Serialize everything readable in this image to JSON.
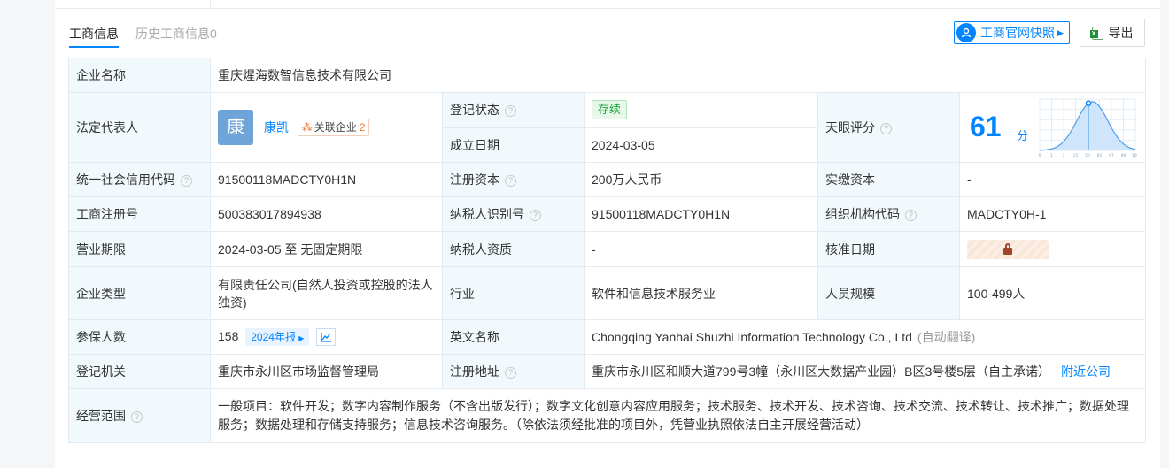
{
  "tabs": {
    "active": "工商信息",
    "history": "历史工商信息0"
  },
  "actions": {
    "official_snapshot": "工商官网快照",
    "export": "导出"
  },
  "info": {
    "company_name_label": "企业名称",
    "company_name": "重庆煋海数智信息技术有限公司",
    "legal_rep_label": "法定代表人",
    "legal_rep_avatar": "康",
    "legal_rep_name": "康凯",
    "legal_rep_assoc_label": "关联企业",
    "legal_rep_assoc_count": "2",
    "reg_status_label": "登记状态",
    "reg_status": "存续",
    "found_date_label": "成立日期",
    "found_date": "2024-03-05",
    "rating_label": "天眼评分",
    "rating_score": "61",
    "rating_unit": "分",
    "credit_code_label": "统一社会信用代码",
    "credit_code": "91500118MADCTY0H1N",
    "reg_capital_label": "注册资本",
    "reg_capital": "200万人民币",
    "paid_capital_label": "实缴资本",
    "paid_capital": "-",
    "reg_no_label": "工商注册号",
    "reg_no": "500383017894938",
    "taxpayer_id_label": "纳税人识别号",
    "taxpayer_id": "91500118MADCTY0H1N",
    "org_code_label": "组织机构代码",
    "org_code": "MADCTY0H-1",
    "term_label": "营业期限",
    "term": "2024-03-05 至 无固定期限",
    "taxpayer_qual_label": "纳税人资质",
    "taxpayer_qual": "-",
    "approval_date_label": "核准日期",
    "company_type_label": "企业类型",
    "company_type": "有限责任公司(自然人投资或控股的法人独资)",
    "industry_label": "行业",
    "industry": "软件和信息技术服务业",
    "staff_size_label": "人员规模",
    "staff_size": "100-499人",
    "insured_label": "参保人数",
    "insured_count": "158",
    "insured_year": "2024年报",
    "english_name_label": "英文名称",
    "english_name": "Chongqing Yanhai Shuzhi Information Technology Co., Ltd",
    "auto_translate": "(自动翻译)",
    "authority_label": "登记机关",
    "authority": "重庆市永川区市场监督管理局",
    "address_label": "注册地址",
    "address": "重庆市永川区和顺大道799号3幢（永川区大数据产业园）B区3号楼5层（自主承诺）",
    "nearby": "附近公司",
    "scope_label": "经营范围",
    "scope": "一般项目：软件开发；数字内容制作服务（不含出版发行）；数字文化创意内容应用服务；技术服务、技术开发、技术咨询、技术交流、技术转让、技术推广；数据处理服务；数据处理和存储支持服务；信息技术咨询服务。（除依法须经批准的项目外，凭营业执照依法自主开展经营活动）"
  },
  "chart_data": {
    "type": "area",
    "x_ticks": [
      "0",
      "1",
      "3",
      "15",
      "50",
      "85",
      "97",
      "99",
      "100"
    ],
    "marker_score": 61
  },
  "colors": {
    "accent": "#0084ff",
    "label_bg": "#f2f9fc",
    "status_green": "#1aa63a"
  }
}
